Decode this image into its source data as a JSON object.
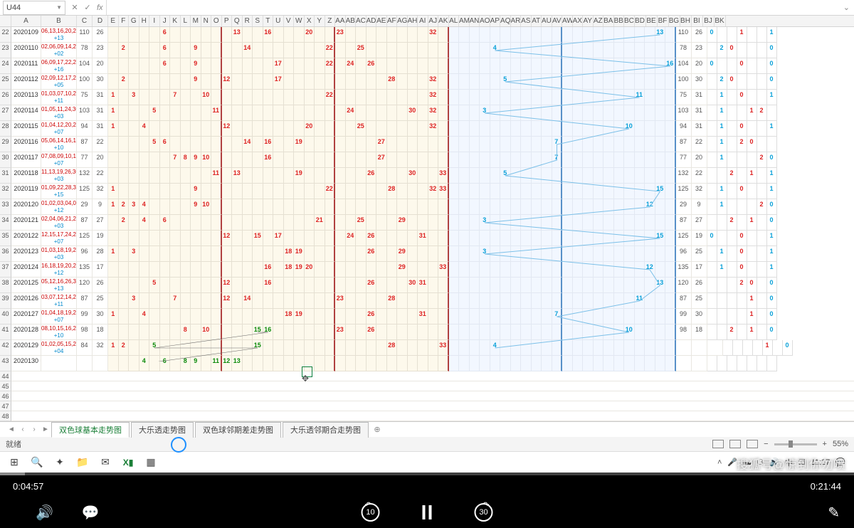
{
  "nameBox": "U44",
  "fx": "fx",
  "colHeaders": [
    "A",
    "B",
    "C",
    "D",
    "E",
    "F",
    "G",
    "H",
    "I",
    "J",
    "K",
    "L",
    "M",
    "N",
    "O",
    "P",
    "Q",
    "R",
    "S",
    "T",
    "U",
    "V",
    "W",
    "X",
    "Y",
    "Z",
    "AA",
    "AB",
    "AC",
    "AD",
    "AE",
    "AF",
    "AG",
    "AH",
    "AI",
    "AJ",
    "AK",
    "AL",
    "AM",
    "AN",
    "AO",
    "AP",
    "AQ",
    "AR",
    "AS",
    "AT",
    "AU",
    "AV",
    "AW",
    "AX",
    "AY",
    "AZ",
    "BA",
    "BB",
    "BC",
    "BD",
    "BE",
    "BF",
    "BG",
    "BH",
    "BI",
    "BJ",
    "BK"
  ],
  "rowHeads": [
    "22",
    "23",
    "24",
    "25",
    "26",
    "27",
    "28",
    "29",
    "30",
    "31",
    "32",
    "33",
    "34",
    "35",
    "36",
    "37",
    "38",
    "39",
    "40",
    "41",
    "42",
    "43",
    "44",
    "45",
    "46",
    "47",
    "48"
  ],
  "rows": [
    {
      "id": "2020109",
      "b1": "06,13,16,20,23,32",
      "b2": "+13",
      "c": "110",
      "d": "26",
      "red": [
        [
          6,
          "6"
        ],
        [
          13,
          "13"
        ],
        [
          16,
          "16"
        ],
        [
          20,
          "20"
        ],
        [
          23,
          "23"
        ],
        [
          32,
          "32"
        ]
      ],
      "blue": "13",
      "bx": 54,
      "cd2": [
        "110",
        "26"
      ],
      "e": [
        "0",
        "",
        "",
        "1",
        "",
        "",
        "1"
      ]
    },
    {
      "id": "2020110",
      "b1": "02,06,09,14,22,25",
      "b2": "+02",
      "c": "78",
      "d": "23",
      "red": [
        [
          2,
          "2"
        ],
        [
          6,
          "6"
        ],
        [
          9,
          "9"
        ],
        [
          14,
          "14"
        ],
        [
          22,
          "22"
        ],
        [
          25,
          "25"
        ]
      ],
      "blue": "4",
      "bx": 38,
      "cd2": [
        "78",
        "23"
      ],
      "e": [
        "",
        "2",
        "0",
        "",
        "",
        "",
        "0"
      ]
    },
    {
      "id": "2020111",
      "b1": "06,09,17,22,24,26",
      "b2": "+16",
      "c": "104",
      "d": "20",
      "red": [
        [
          6,
          "6"
        ],
        [
          9,
          "9"
        ],
        [
          17,
          "17"
        ],
        [
          22,
          "22"
        ],
        [
          24,
          "24"
        ],
        [
          26,
          "26"
        ]
      ],
      "blue": "16",
      "bx": 55,
      "cd2": [
        "104",
        "20"
      ],
      "e": [
        "0",
        "",
        "",
        "0",
        "",
        "",
        "0"
      ]
    },
    {
      "id": "2020112",
      "b1": "02,09,12,17,28,32",
      "b2": "+05",
      "c": "100",
      "d": "30",
      "red": [
        [
          2,
          "2"
        ],
        [
          9,
          "9"
        ],
        [
          12,
          "12"
        ],
        [
          17,
          "17"
        ],
        [
          28,
          "28"
        ],
        [
          32,
          "32"
        ]
      ],
      "blue": "5",
      "bx": 39,
      "cd2": [
        "100",
        "30"
      ],
      "e": [
        "",
        "2",
        "0",
        "",
        "",
        "",
        "0"
      ]
    },
    {
      "id": "2020113",
      "b1": "01,03,07,10,22,32",
      "b2": "+11",
      "c": "75",
      "d": "31",
      "red": [
        [
          1,
          "1"
        ],
        [
          3,
          "3"
        ],
        [
          7,
          "7"
        ],
        [
          10,
          "10"
        ],
        [
          22,
          "22"
        ],
        [
          32,
          "32"
        ]
      ],
      "blue": "11",
      "bx": 52,
      "cd2": [
        "75",
        "31"
      ],
      "e": [
        "",
        "1",
        "",
        "0",
        "",
        "",
        "1"
      ]
    },
    {
      "id": "2020114",
      "b1": "01,05,11,24,30,32",
      "b2": "+03",
      "c": "103",
      "d": "31",
      "red": [
        [
          1,
          "1"
        ],
        [
          5,
          "5"
        ],
        [
          11,
          "11"
        ],
        [
          24,
          "24"
        ],
        [
          30,
          "30"
        ],
        [
          32,
          "32"
        ]
      ],
      "blue": "3",
      "bx": 37,
      "cd2": [
        "103",
        "31"
      ],
      "e": [
        "",
        "1",
        "",
        "",
        "1",
        "2",
        ""
      ]
    },
    {
      "id": "2020115",
      "b1": "01,04,12,20,25,32",
      "b2": "+07",
      "c": "94",
      "d": "31",
      "red": [
        [
          1,
          "1"
        ],
        [
          4,
          "4"
        ],
        [
          12,
          "12"
        ],
        [
          20,
          "20"
        ],
        [
          25,
          "25"
        ],
        [
          32,
          "32"
        ]
      ],
      "blue": "10",
      "bx": 51,
      "cd2": [
        "94",
        "31"
      ],
      "e": [
        "",
        "1",
        "",
        "0",
        "",
        "",
        "1"
      ]
    },
    {
      "id": "2020116",
      "b1": "05,06,14,16,19,27",
      "b2": "+10",
      "c": "87",
      "d": "22",
      "red": [
        [
          5,
          "5"
        ],
        [
          6,
          "6"
        ],
        [
          14,
          "14"
        ],
        [
          16,
          "16"
        ],
        [
          19,
          "19"
        ],
        [
          27,
          "27"
        ]
      ],
      "blue": "7",
      "bx": 44,
      "cd2": [
        "87",
        "22"
      ],
      "e": [
        "",
        "1",
        "",
        "2",
        "0",
        "",
        ""
      ]
    },
    {
      "id": "2020117",
      "b1": "07,08,09,10,16,27",
      "b2": "+07",
      "c": "77",
      "d": "20",
      "red": [
        [
          7,
          "7"
        ],
        [
          8,
          "8"
        ],
        [
          9,
          "9"
        ],
        [
          10,
          "10"
        ],
        [
          16,
          "16"
        ],
        [
          27,
          "27"
        ]
      ],
      "blue": "7",
      "bx": 44,
      "cd2": [
        "77",
        "20"
      ],
      "e": [
        "",
        "1",
        "",
        "",
        "",
        "2",
        "0"
      ]
    },
    {
      "id": "2020118",
      "b1": "11,13,19,26,30,33",
      "b2": "+03",
      "c": "132",
      "d": "22",
      "red": [
        [
          11,
          "11"
        ],
        [
          13,
          "13"
        ],
        [
          19,
          "19"
        ],
        [
          26,
          "26"
        ],
        [
          30,
          "30"
        ],
        [
          33,
          "33"
        ]
      ],
      "blue": "5",
      "bx": 39,
      "cd2": [
        "132",
        "22"
      ],
      "e": [
        "",
        "",
        "2",
        "",
        "1",
        "",
        "1"
      ]
    },
    {
      "id": "2020119",
      "b1": "01,09,22,28,32,33",
      "b2": "+15",
      "c": "125",
      "d": "32",
      "red": [
        [
          1,
          "1"
        ],
        [
          9,
          "9"
        ],
        [
          22,
          "22"
        ],
        [
          28,
          "28"
        ],
        [
          32,
          "32"
        ],
        [
          33,
          "33"
        ]
      ],
      "blue": "15",
      "bx": 54,
      "cd2": [
        "125",
        "32"
      ],
      "e": [
        "",
        "1",
        "",
        "0",
        "",
        "",
        "1"
      ]
    },
    {
      "id": "2020120",
      "b1": "01,02,03,04,09,10",
      "b2": "+12",
      "c": "29",
      "d": "9",
      "red": [
        [
          1,
          "1"
        ],
        [
          2,
          "2"
        ],
        [
          3,
          "3"
        ],
        [
          4,
          "4"
        ],
        [
          9,
          "9"
        ],
        [
          10,
          "10"
        ]
      ],
      "blue": "12",
      "bx": 53,
      "cd2": [
        "29",
        "9"
      ],
      "e": [
        "",
        "1",
        "",
        "",
        "",
        "2",
        "0"
      ]
    },
    {
      "id": "2020121",
      "b1": "02,04,06,21,25,29",
      "b2": "+03",
      "c": "87",
      "d": "27",
      "red": [
        [
          2,
          "2"
        ],
        [
          4,
          "4"
        ],
        [
          6,
          "6"
        ],
        [
          21,
          "21"
        ],
        [
          25,
          "25"
        ],
        [
          29,
          "29"
        ]
      ],
      "blue": "3",
      "bx": 37,
      "cd2": [
        "87",
        "27"
      ],
      "e": [
        "",
        "",
        "2",
        "",
        "1",
        "",
        "0"
      ]
    },
    {
      "id": "2020122",
      "b1": "12,15,17,24,26,31",
      "b2": "+07",
      "c": "125",
      "d": "19",
      "red": [
        [
          12,
          "12"
        ],
        [
          15,
          "15"
        ],
        [
          17,
          "17"
        ],
        [
          24,
          "24"
        ],
        [
          26,
          "26"
        ],
        [
          31,
          "31"
        ]
      ],
      "blue": "15",
      "bx": 54,
      "cd2": [
        "125",
        "19"
      ],
      "e": [
        "0",
        "",
        "",
        "0",
        "",
        "",
        "1"
      ]
    },
    {
      "id": "2020123",
      "b1": "01,03,18,19,26,29",
      "b2": "+03",
      "c": "96",
      "d": "28",
      "red": [
        [
          1,
          "1"
        ],
        [
          3,
          "3"
        ],
        [
          18,
          "18"
        ],
        [
          19,
          "19"
        ],
        [
          26,
          "26"
        ],
        [
          29,
          "29"
        ]
      ],
      "blue": "3",
      "bx": 37,
      "cd2": [
        "96",
        "25"
      ],
      "e": [
        "",
        "1",
        "",
        "0",
        "",
        "",
        "1"
      ]
    },
    {
      "id": "2020124",
      "b1": "16,18,19,20,29,33",
      "b2": "+12",
      "c": "135",
      "d": "17",
      "red": [
        [
          16,
          "16"
        ],
        [
          18,
          "18"
        ],
        [
          19,
          "19"
        ],
        [
          20,
          "20"
        ],
        [
          29,
          "29"
        ],
        [
          33,
          "33"
        ]
      ],
      "blue": "12",
      "bx": 53,
      "cd2": [
        "135",
        "17"
      ],
      "e": [
        "",
        "1",
        "",
        "0",
        "",
        "",
        "1"
      ]
    },
    {
      "id": "2020125",
      "b1": "05,12,16,26,30,31",
      "b2": "+13",
      "c": "120",
      "d": "26",
      "red": [
        [
          5,
          "5"
        ],
        [
          12,
          "12"
        ],
        [
          16,
          "16"
        ],
        [
          26,
          "26"
        ],
        [
          30,
          "30"
        ],
        [
          31,
          "31"
        ]
      ],
      "blue": "13",
      "bx": 54,
      "cd2": [
        "120",
        "26"
      ],
      "e": [
        "",
        "",
        "",
        "2",
        "0",
        "",
        "0"
      ]
    },
    {
      "id": "2020126",
      "b1": "03,07,12,14,23,28",
      "b2": "+11",
      "c": "87",
      "d": "25",
      "red": [
        [
          3,
          "3"
        ],
        [
          7,
          "7"
        ],
        [
          12,
          "12"
        ],
        [
          14,
          "14"
        ],
        [
          23,
          "23"
        ],
        [
          28,
          "28"
        ]
      ],
      "blue": "11",
      "bx": 52,
      "cd2": [
        "87",
        "25"
      ],
      "e": [
        "",
        "",
        "",
        "",
        "1",
        "",
        "0"
      ]
    },
    {
      "id": "2020127",
      "b1": "01,04,18,19,26,31",
      "b2": "+07",
      "c": "99",
      "d": "30",
      "red": [
        [
          1,
          "1"
        ],
        [
          4,
          "4"
        ],
        [
          18,
          "18"
        ],
        [
          19,
          "19"
        ],
        [
          26,
          "26"
        ],
        [
          31,
          "31"
        ]
      ],
      "blue": "7",
      "bx": 44,
      "cd2": [
        "99",
        "30"
      ],
      "e": [
        "",
        "",
        "",
        "",
        "1",
        "",
        "0"
      ]
    },
    {
      "id": "2020128",
      "b1": "08,10,15,16,23,26",
      "b2": "+10",
      "c": "98",
      "d": "18",
      "red": [
        [
          8,
          "8"
        ],
        [
          10,
          "10"
        ],
        [
          23,
          "23"
        ],
        [
          26,
          "26"
        ]
      ],
      "grn": [
        [
          15,
          "15"
        ],
        [
          16,
          "16"
        ]
      ],
      "blue": "10",
      "bx": 51,
      "cd2": [
        "98",
        "18"
      ],
      "e": [
        "",
        "",
        "2",
        "",
        "1",
        "",
        "0"
      ]
    },
    {
      "id": "2020129",
      "b1": "01,02,05,15,28,33",
      "b2": "+04",
      "c": "84",
      "d": "32",
      "red": [
        [
          1,
          "1"
        ],
        [
          2,
          "2"
        ],
        [
          28,
          "28"
        ],
        [
          33,
          "33"
        ]
      ],
      "grn": [
        [
          5,
          "5"
        ],
        [
          15,
          "15"
        ]
      ],
      "blue": "4",
      "bx": 38,
      "cd2": [
        "",
        "",
        ""
      ],
      "e": [
        "",
        "",
        "",
        "",
        "1",
        "",
        "0"
      ]
    },
    {
      "id": "2020130",
      "b1": "",
      "b2": "",
      "c": "",
      "d": "",
      "red": [],
      "grn": [
        [
          4,
          "4"
        ],
        [
          6,
          "6"
        ],
        [
          8,
          "8"
        ],
        [
          9,
          "9"
        ],
        [
          11,
          "11"
        ],
        [
          12,
          "12"
        ],
        [
          13,
          "13"
        ]
      ],
      "blue": "",
      "bx": 0,
      "cd2": [
        "",
        ""
      ],
      "e": [
        "",
        "",
        "",
        "",
        "",
        "",
        ""
      ]
    }
  ],
  "sheetTabs": [
    "双色球基本走势图",
    "大乐透走势图",
    "双色球邻期差走势图",
    "大乐透邻期合走势图"
  ],
  "statusLeft": "就绪",
  "zoom": "55%",
  "taskbarTime": "11:27",
  "playElapsed": "0:04:57",
  "playTotal": "0:21:44",
  "skipBack": "10",
  "skipFwd": "30",
  "watermark": "搜狐号@惊到你勿喷"
}
